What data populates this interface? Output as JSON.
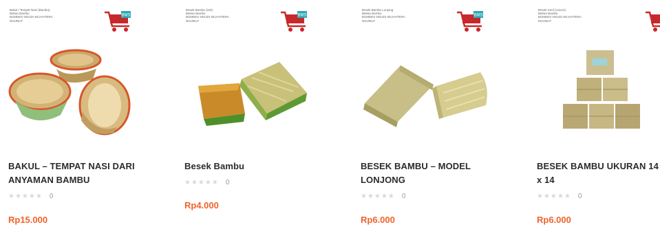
{
  "products": [
    {
      "caption": [
        "Bakul / Tempat Nasi (Bambu)",
        "Bahan Bambu",
        "BUMDES NGUDI SEJAHTERA",
        "NGUNUT"
      ],
      "title_line1": "BAKUL – TEMPAT NASI DARI",
      "title_line2": "ANYAMAN BAMBU",
      "rating_stars": 0,
      "rating_count": "0",
      "price": "Rp15.000"
    },
    {
      "caption": [
        "Besek Bambu (Set)",
        "Bahan Bambu",
        "BUMDES NGUDI SEJAHTERA",
        "NGUNUT"
      ],
      "title_line1": "Besek Bambu",
      "title_line2": "",
      "rating_stars": 0,
      "rating_count": "0",
      "price": "Rp4.000"
    },
    {
      "caption": [
        "Besek Bambu Lonjong",
        "Bahan Bambu",
        "BUMDES NGUDI SEJAHTERA",
        "NGUNUT"
      ],
      "title_line1": "BESEK BAMBU – MODEL",
      "title_line2": "LONJONG",
      "rating_stars": 0,
      "rating_count": "0",
      "price": "Rp6.000"
    },
    {
      "caption": [
        "Besek Kecil (14x14)",
        "Bahan Bambu",
        "BUMDES NGUDI SEJAHTERA",
        "NGUNUT"
      ],
      "title_line1": "BESEK BAMBU UKURAN 14",
      "title_line2": "x 14",
      "rating_stars": 0,
      "rating_count": "0",
      "price": "Rp6.000"
    }
  ],
  "icons": {
    "cart": "shopping-cart-logo-icon",
    "star": "star-icon"
  },
  "colors": {
    "price": "#f0622a",
    "title": "#2b2b2b",
    "star_empty": "#d9d9d9",
    "cart_red": "#c8282a",
    "cart_teal": "#2aa9b8"
  }
}
